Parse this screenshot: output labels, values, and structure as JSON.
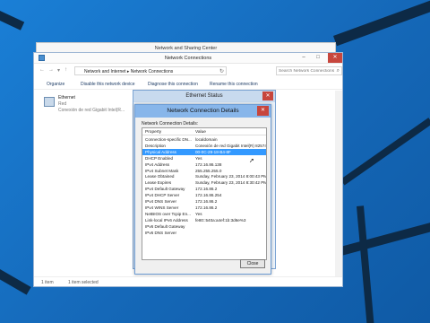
{
  "network_sharing_center": {
    "title": "Network and Sharing Center"
  },
  "network_connections": {
    "title": "Network Connections",
    "breadcrumb": [
      "Network and Internet",
      "Network Connections"
    ],
    "search_placeholder": "Search Network Connections",
    "toolbar": {
      "organize": "Organize",
      "disable": "Disable this network device",
      "diagnose": "Diagnose this connection",
      "rename": "Rename this connection"
    },
    "connection": {
      "name": "Ethernet",
      "network": "Red",
      "adapter": "Conexión de red Gigabit Intel(R..."
    },
    "status": {
      "items": "1 item",
      "selected": "1 item selected"
    }
  },
  "ethernet_status": {
    "title": "Ethernet Status"
  },
  "details": {
    "title": "Network Connection Details",
    "label": "Network Connection Details:",
    "columns": {
      "property": "Property",
      "value": "Value"
    },
    "rows": [
      {
        "property": "Connection-specific DN...",
        "value": "localdomain"
      },
      {
        "property": "Description",
        "value": "Conexión de red Gigabit Intel(R) 82574L"
      },
      {
        "property": "Physical Address",
        "value": "00-0C-29-18-B4-8F"
      },
      {
        "property": "DHCP Enabled",
        "value": "Yes"
      },
      {
        "property": "IPv4 Address",
        "value": "172.16.86.138"
      },
      {
        "property": "IPv4 Subnet Mask",
        "value": "255.255.255.0"
      },
      {
        "property": "Lease Obtained",
        "value": "Sunday, February 23, 2014 8:00:43 PM"
      },
      {
        "property": "Lease Expires",
        "value": "Sunday, February 23, 2014 8:30:42 PM"
      },
      {
        "property": "IPv4 Default Gateway",
        "value": "172.16.86.2"
      },
      {
        "property": "IPv4 DHCP Server",
        "value": "172.16.86.254"
      },
      {
        "property": "IPv4 DNS Server",
        "value": "172.16.86.2"
      },
      {
        "property": "IPv4 WINS Server",
        "value": "172.16.86.2"
      },
      {
        "property": "NetBIOS over Tcpip En...",
        "value": "Yes"
      },
      {
        "property": "Link-local IPv6 Address",
        "value": "fe80::540a:a4ef:1b:3d6e%3"
      },
      {
        "property": "IPv6 Default Gateway",
        "value": ""
      },
      {
        "property": "IPv6 DNS Server",
        "value": ""
      }
    ],
    "selected_row": 2,
    "close_label": "Close"
  }
}
